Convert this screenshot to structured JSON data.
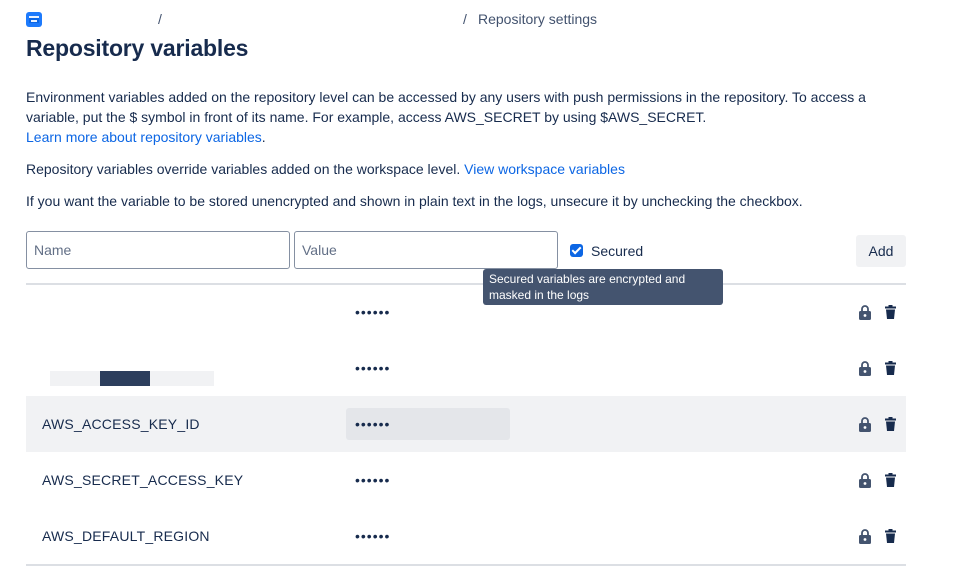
{
  "breadcrumb": {
    "separator": "/",
    "current": "Repository settings",
    "icon": "repository-icon"
  },
  "page": {
    "title": "Repository variables"
  },
  "info": {
    "intro_text": "Environment variables added on the repository level can be accessed by any users with push permissions in the repository. To access a variable, put the $ symbol in front of its name. For example, access AWS_SECRET by using $AWS_SECRET.",
    "learn_more_link": "Learn more about repository variables",
    "learn_more_suffix": ".",
    "override_text": "Repository variables override variables added on the workspace level.",
    "workspace_link": "View workspace variables",
    "unsecure_text": "If you want the variable to be stored unencrypted and shown in plain text in the logs, unsecure it by unchecking the checkbox."
  },
  "form": {
    "name_placeholder": "Name",
    "value_placeholder": "Value",
    "secured_label": "Secured",
    "secured_checked": true,
    "add_label": "Add",
    "tooltip": "Secured variables are encrypted and masked in the logs"
  },
  "variables": [
    {
      "name": "",
      "value": "••••••"
    },
    {
      "name": "",
      "value": "••••••"
    },
    {
      "name": "AWS_ACCESS_KEY_ID",
      "value": "••••••"
    },
    {
      "name": "AWS_SECRET_ACCESS_KEY",
      "value": "••••••"
    },
    {
      "name": "AWS_DEFAULT_REGION",
      "value": "••••••"
    }
  ],
  "icons": {
    "lock": "lock-icon",
    "delete": "trash-icon"
  },
  "colors": {
    "link": "#0c66e4",
    "checkbox": "#0c66e4",
    "tooltip_bg": "#44546f",
    "text": "#172b4d"
  }
}
